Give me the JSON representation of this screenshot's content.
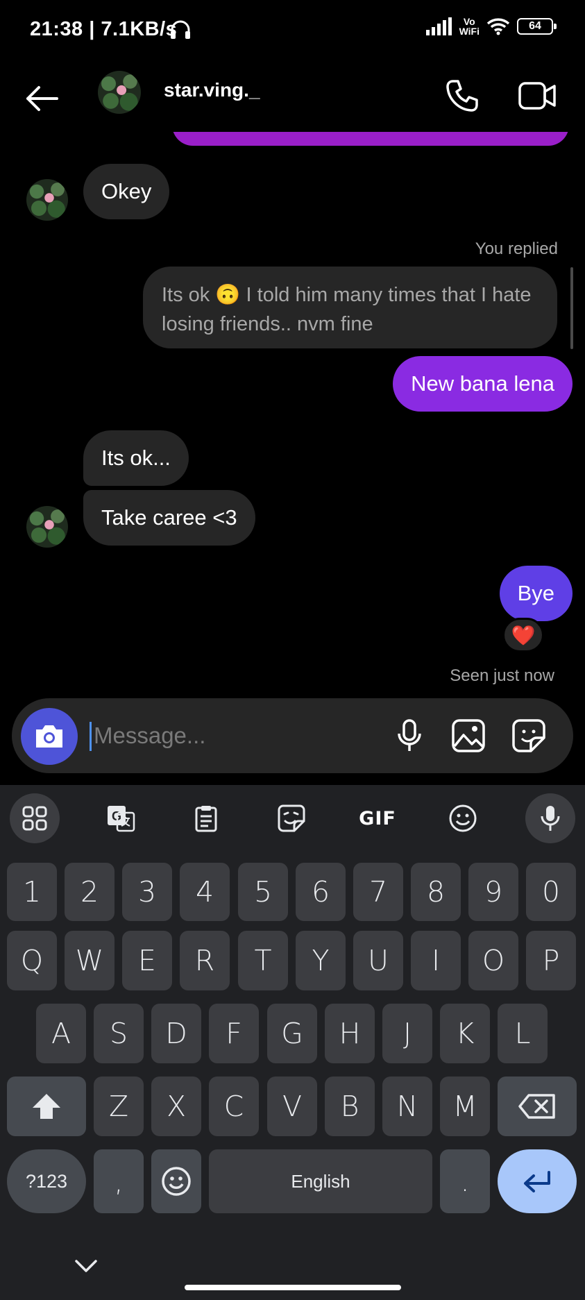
{
  "status_bar": {
    "time_speed": "21:38 | 7.1KB/s",
    "network_label_line1": "Vo",
    "network_label_line2": "WiFi",
    "battery": "64"
  },
  "header": {
    "contact_name": "star.ving._"
  },
  "messages": {
    "okey": "Okey",
    "you_replied": "You replied",
    "reply_quote": "Its ok 🙃 I told him many times that I hate losing friends.. nvm fine",
    "new_bana_lena": "New bana lena",
    "its_ok": "Its ok...",
    "take_care": "Take caree <3",
    "bye": "Bye",
    "reaction": "❤️",
    "seen": "Seen just now"
  },
  "composer": {
    "placeholder": "Message..."
  },
  "keyboard": {
    "toolbar": {
      "gif_label": "GIF"
    },
    "row_numbers": [
      "1",
      "2",
      "3",
      "4",
      "5",
      "6",
      "7",
      "8",
      "9",
      "0"
    ],
    "row_q": [
      "Q",
      "W",
      "E",
      "R",
      "T",
      "Y",
      "U",
      "I",
      "O",
      "P"
    ],
    "row_a": [
      "A",
      "S",
      "D",
      "F",
      "G",
      "H",
      "J",
      "K",
      "L"
    ],
    "row_z": [
      "Z",
      "X",
      "C",
      "V",
      "B",
      "N",
      "M"
    ],
    "symbols_key": "?123",
    "comma_key": ",",
    "space_key": "English",
    "period_key": "."
  },
  "colors": {
    "accent_purple": "#8a2be2",
    "accent_violet": "#5f3fe6",
    "camera_button": "#4e54d8",
    "enter_key": "#a8c7fa"
  }
}
